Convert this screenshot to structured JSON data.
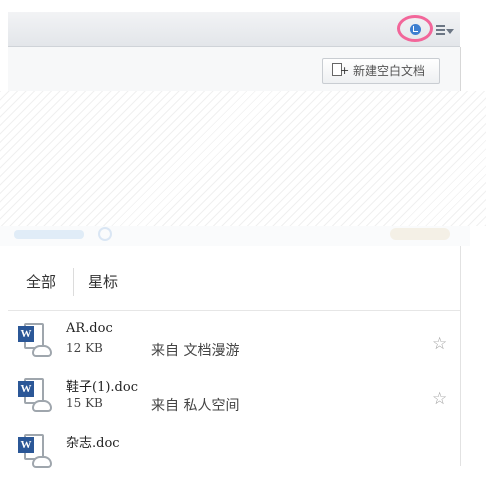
{
  "toolbar": {
    "cloud_icon": "cloud-sync-icon",
    "menu_icon": "list-menu-icon",
    "highlight_color": "#f2669a"
  },
  "subbar": {
    "new_doc_label": "新建空白文档"
  },
  "panel": {
    "tabs": [
      {
        "label": "全部"
      },
      {
        "label": "星标"
      }
    ],
    "source_prefix": "来自",
    "files": [
      {
        "name": "AR.doc",
        "size": "12 KB",
        "source": "文档漫游"
      },
      {
        "name": "鞋子(1).doc",
        "size": "15 KB",
        "source": "私人空间"
      },
      {
        "name": "杂志.doc",
        "size": "",
        "source": ""
      }
    ]
  }
}
